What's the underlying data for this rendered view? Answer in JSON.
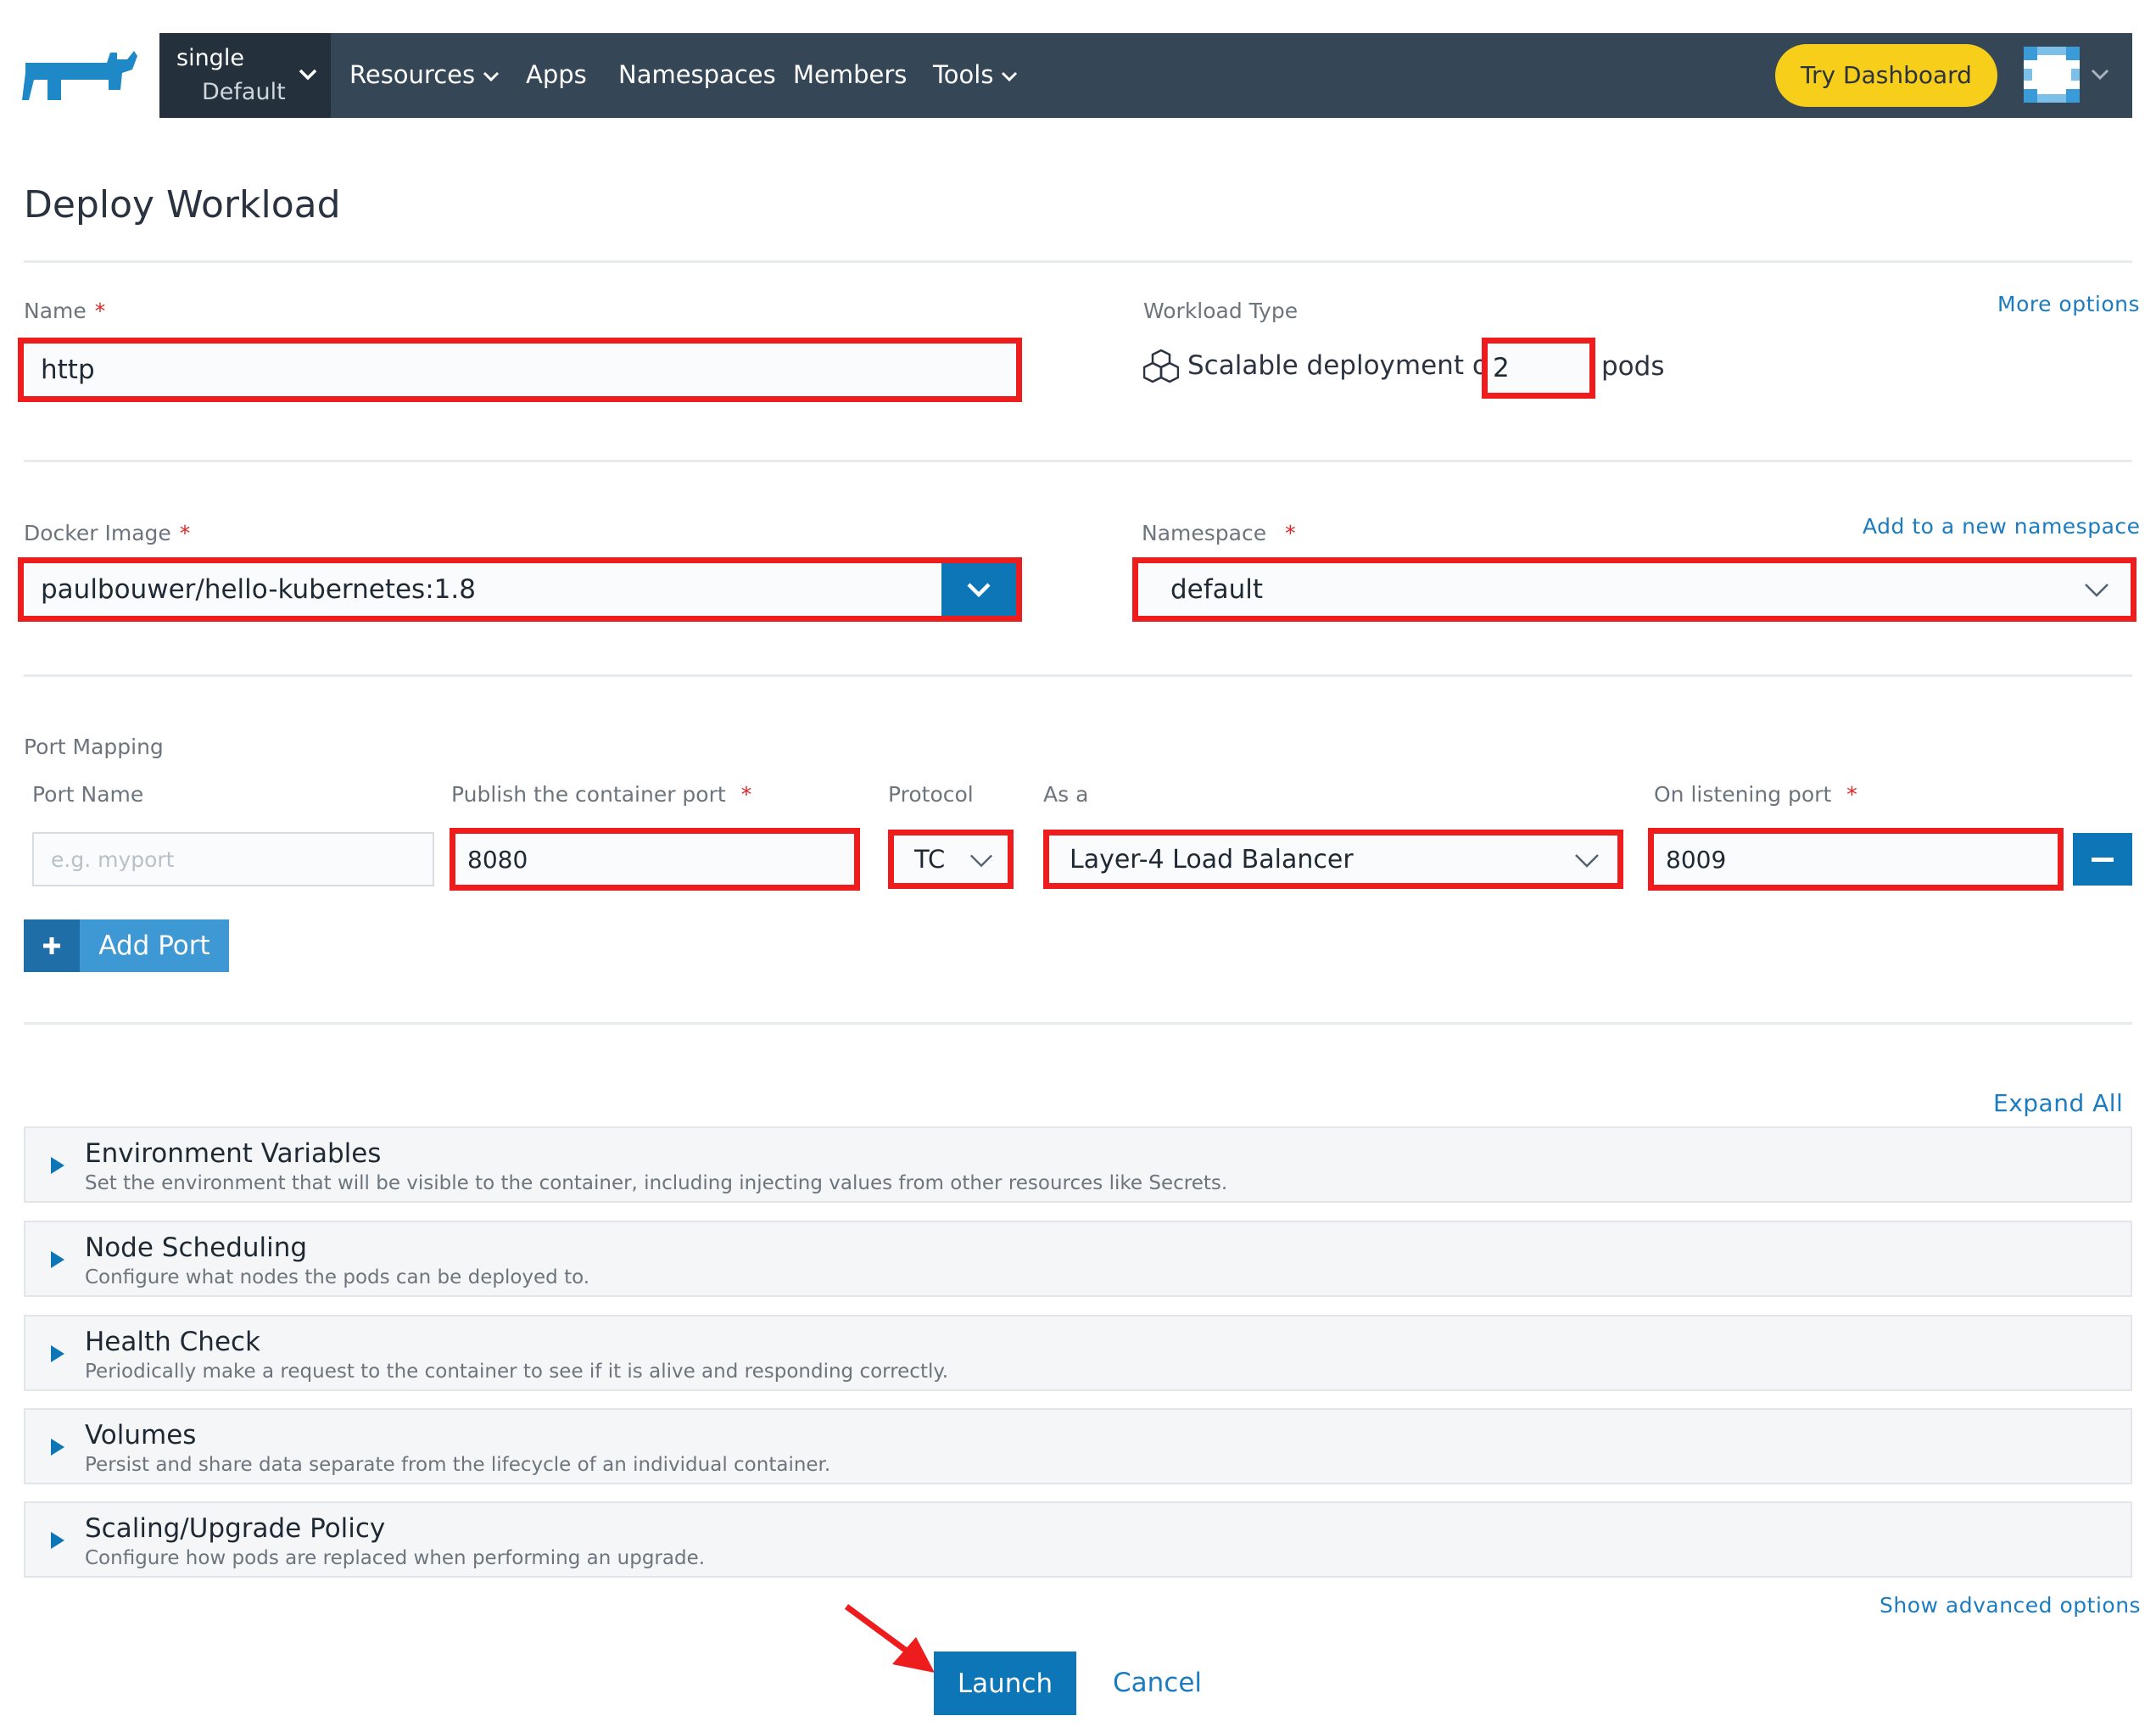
{
  "header": {
    "cluster_name": "single",
    "project_name": "Default",
    "nav": [
      "Resources",
      "Apps",
      "Namespaces",
      "Members",
      "Tools"
    ],
    "try_dashboard": "Try Dashboard"
  },
  "page": {
    "title": "Deploy Workload"
  },
  "form": {
    "name_label": "Name",
    "required_mark": "*",
    "name_value": "http",
    "workload_type_label": "Workload Type",
    "more_options": "More options",
    "scalable_text": "Scalable deployment of",
    "pods_count": "2",
    "pods_text": "pods",
    "docker_image_label": "Docker Image",
    "docker_image_value": "paulbouwer/hello-kubernetes:1.8",
    "namespace_label": "Namespace",
    "add_namespace": "Add to a new namespace",
    "namespace_value": "default"
  },
  "ports": {
    "section_label": "Port Mapping",
    "col_port_name": "Port Name",
    "col_publish": "Publish the container port",
    "col_protocol": "Protocol",
    "col_as_a": "As a",
    "col_listening": "On listening port",
    "port_name_placeholder": "e.g. myport",
    "container_port": "8080",
    "protocol": "TC",
    "as_a": "Layer-4 Load Balancer",
    "listening_port": "8009",
    "add_port": "Add Port"
  },
  "sections": {
    "expand_all": "Expand All",
    "items": [
      {
        "title": "Environment Variables",
        "desc": "Set the environment that will be visible to the container, including injecting values from other resources like Secrets."
      },
      {
        "title": "Node Scheduling",
        "desc": "Configure what nodes the pods can be deployed to."
      },
      {
        "title": "Health Check",
        "desc": "Periodically make a request to the container to see if it is alive and responding correctly."
      },
      {
        "title": "Volumes",
        "desc": "Persist and share data separate from the lifecycle of an individual container."
      },
      {
        "title": "Scaling/Upgrade Policy",
        "desc": "Configure how pods are replaced when performing an upgrade."
      }
    ],
    "show_advanced": "Show advanced options"
  },
  "actions": {
    "launch": "Launch",
    "cancel": "Cancel"
  },
  "colors": {
    "accent": "#0c76b7",
    "highlight": "#ee1c1c",
    "topbar": "#354656",
    "try_button": "#f7ce1a"
  },
  "icons": [
    "rancher-logo-icon",
    "chevron-down-icon",
    "avatar-icon",
    "cubes-icon",
    "plus-icon",
    "minus-icon",
    "caret-right-icon",
    "annotation-arrow-icon"
  ]
}
